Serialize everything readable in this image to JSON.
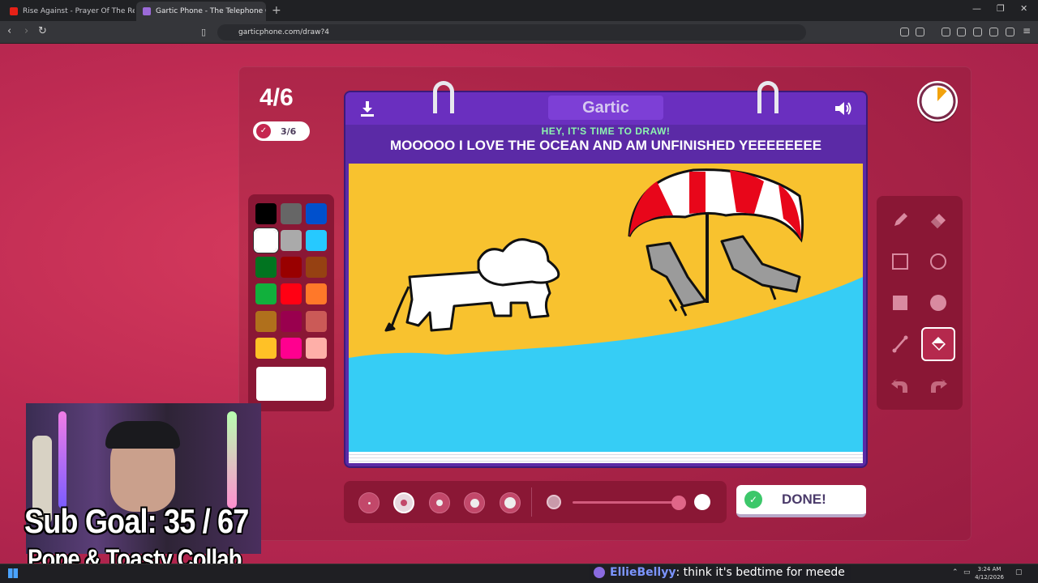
{
  "browser": {
    "tabs": [
      {
        "title": "Rise Against - Prayer Of The Refu",
        "active": false
      },
      {
        "title": "Gartic Phone - The Telephone G",
        "active": true
      }
    ],
    "url": "garticphone.com/draw?4"
  },
  "game": {
    "round": "4/6",
    "done_count": "3/6",
    "brand": "Gartic",
    "hint": "HEY, IT'S TIME TO DRAW!",
    "prompt": "MOOOOO I LOVE THE OCEAN AND AM UNFINISHED YEEEEEEEE",
    "done_label": "DONE!",
    "timer_elapsed_fraction": 0.12,
    "selected_color": "#ffffff",
    "selected_tool": "fill",
    "selected_size_index": 1,
    "palette": [
      "#000000",
      "#666666",
      "#0050cd",
      "#ffffff",
      "#aaaaaa",
      "#26c9ff",
      "#017420",
      "#990000",
      "#964112",
      "#11b03c",
      "#ff0013",
      "#ff7829",
      "#b0701c",
      "#99004e",
      "#cb5a57",
      "#ffc126",
      "#ff008f",
      "#feafa8"
    ],
    "tools": [
      {
        "name": "pencil-tool"
      },
      {
        "name": "eraser-tool"
      },
      {
        "name": "rectangle-tool"
      },
      {
        "name": "ellipse-tool"
      },
      {
        "name": "filled-rectangle-tool"
      },
      {
        "name": "filled-ellipse-tool"
      },
      {
        "name": "line-tool"
      },
      {
        "name": "fill-tool"
      },
      {
        "name": "undo-tool"
      },
      {
        "name": "redo-tool"
      }
    ]
  },
  "overlay": {
    "sub_goal": "Sub Goal:  35 / 67",
    "collab": "Pope & Toasty Collab"
  },
  "chat": {
    "user": "EllieBellyy",
    "message": ": think it's bedtime for meede"
  },
  "taskbar": {
    "time": "3:24 AM",
    "date": "4/12/2026"
  }
}
